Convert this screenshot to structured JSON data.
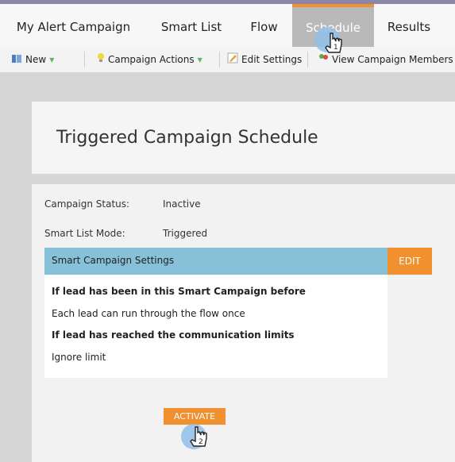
{
  "tabs": {
    "campaign": "My Alert Campaign",
    "smart_list": "Smart List",
    "flow": "Flow",
    "schedule": "Schedule",
    "results": "Results"
  },
  "toolbar": {
    "new_label": "New",
    "campaign_actions_label": "Campaign Actions",
    "edit_settings_label": "Edit Settings",
    "view_members_label": "View Campaign Members"
  },
  "page": {
    "title": "Triggered Campaign Schedule"
  },
  "status": {
    "campaign_status_label": "Campaign Status:",
    "campaign_status_value": "Inactive",
    "smart_list_mode_label": "Smart List Mode:",
    "smart_list_mode_value": "Triggered"
  },
  "settings": {
    "header": "Smart Campaign Settings",
    "edit_label": "EDIT",
    "q1": "If lead has been in this Smart Campaign before",
    "a1": "Each lead can run through the flow once",
    "q2": "If lead has reached the communication limits",
    "a2": "Ignore limit"
  },
  "activate_label": "ACTIVATE",
  "step_markers": {
    "first": "1",
    "second": "2"
  },
  "colors": {
    "accent": "#f0902e",
    "settings_header": "#86c1d8",
    "active_tab": "#b9b9b9"
  }
}
